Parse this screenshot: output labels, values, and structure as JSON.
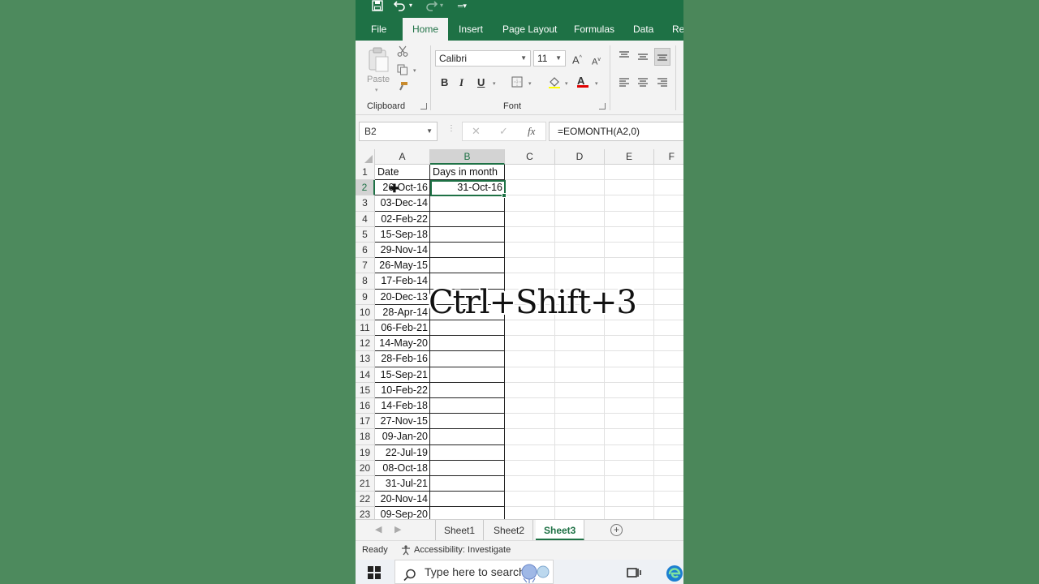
{
  "ribbon_tabs": [
    "File",
    "Home",
    "Insert",
    "Page Layout",
    "Formulas",
    "Data",
    "Re"
  ],
  "clipboard": {
    "paste_label": "Paste",
    "group_label": "Clipboard"
  },
  "font": {
    "name": "Calibri",
    "size": "11",
    "group_label": "Font",
    "bold": "B",
    "italic": "I",
    "underline": "U"
  },
  "formula_bar": {
    "name_box": "B2",
    "formula": "=EOMONTH(A2,0)",
    "fx": "fx"
  },
  "columns": [
    "A",
    "B",
    "C",
    "D",
    "E",
    "F"
  ],
  "rows": [
    {
      "n": "1",
      "a": "Date",
      "b": "Days in month"
    },
    {
      "n": "2",
      "a": "26-Oct-16",
      "b": "31-Oct-16"
    },
    {
      "n": "3",
      "a": "03-Dec-14",
      "b": ""
    },
    {
      "n": "4",
      "a": "02-Feb-22",
      "b": ""
    },
    {
      "n": "5",
      "a": "15-Sep-18",
      "b": ""
    },
    {
      "n": "6",
      "a": "29-Nov-14",
      "b": ""
    },
    {
      "n": "7",
      "a": "26-May-15",
      "b": ""
    },
    {
      "n": "8",
      "a": "17-Feb-14",
      "b": ""
    },
    {
      "n": "9",
      "a": "20-Dec-13",
      "b": ""
    },
    {
      "n": "10",
      "a": "28-Apr-14",
      "b": ""
    },
    {
      "n": "11",
      "a": "06-Feb-21",
      "b": ""
    },
    {
      "n": "12",
      "a": "14-May-20",
      "b": ""
    },
    {
      "n": "13",
      "a": "28-Feb-16",
      "b": ""
    },
    {
      "n": "14",
      "a": "15-Sep-21",
      "b": ""
    },
    {
      "n": "15",
      "a": "10-Feb-22",
      "b": ""
    },
    {
      "n": "16",
      "a": "14-Feb-18",
      "b": ""
    },
    {
      "n": "17",
      "a": "27-Nov-15",
      "b": ""
    },
    {
      "n": "18",
      "a": "09-Jan-20",
      "b": ""
    },
    {
      "n": "19",
      "a": "22-Jul-19",
      "b": ""
    },
    {
      "n": "20",
      "a": "08-Oct-18",
      "b": ""
    },
    {
      "n": "21",
      "a": "31-Jul-21",
      "b": ""
    },
    {
      "n": "22",
      "a": "20-Nov-14",
      "b": ""
    },
    {
      "n": "23",
      "a": "09-Sep-20",
      "b": ""
    }
  ],
  "overlay_text": "Ctrl+Shift+3",
  "sheets": [
    "Sheet1",
    "Sheet2",
    "Sheet3"
  ],
  "active_sheet": "Sheet3",
  "status": {
    "ready": "Ready",
    "accessibility": "Accessibility: Investigate"
  },
  "taskbar": {
    "search_placeholder": "Type here to search"
  },
  "colors": {
    "excel_green": "#1e7145",
    "background_green": "#4d8a5d"
  }
}
